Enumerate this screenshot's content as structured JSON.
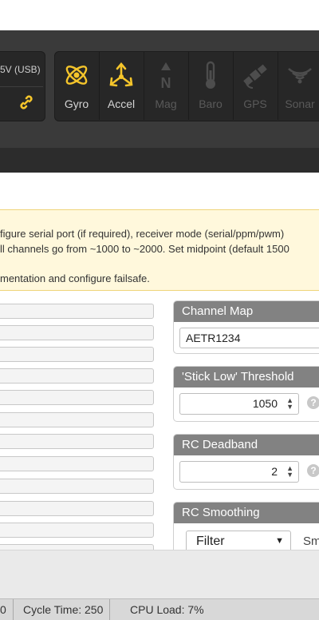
{
  "header": {
    "voltage_label": "5V (USB)",
    "link_icon": "link-icon",
    "sensors": [
      {
        "label": "Gyro",
        "icon": "gyro-icon",
        "active": true
      },
      {
        "label": "Accel",
        "icon": "accel-icon",
        "active": true
      },
      {
        "label": "Mag",
        "icon": "mag-icon",
        "active": false
      },
      {
        "label": "Baro",
        "icon": "baro-icon",
        "active": false
      },
      {
        "label": "GPS",
        "icon": "gps-icon",
        "active": false
      },
      {
        "label": "Sonar",
        "icon": "sonar-icon",
        "active": false
      }
    ],
    "active_color": "#f5c52b",
    "inactive_color": "#4d4d4d"
  },
  "notice": {
    "line1": "figure serial port (if required), receiver mode (serial/ppm/pwm)",
    "line2": "ll channels go from ~1000 to ~2000. Set midpoint (default 1500",
    "line3": "mentation and configure failsafe.",
    "background": "#fff8dc"
  },
  "channel_map": {
    "title": "Channel Map",
    "value": "AETR1234"
  },
  "stick_low": {
    "title": "'Stick Low' Threshold",
    "value": "1050",
    "help": "?"
  },
  "rc_deadband": {
    "title": "RC Deadband",
    "value": "2",
    "help": "?"
  },
  "rc_smoothing": {
    "title": "RC Smoothing",
    "type_value": "Filter",
    "label_partial": "Sm"
  },
  "status_bar": {
    "left_partial": "0",
    "cycle_time": "Cycle Time: 250",
    "cpu_load": "CPU Load: 7%"
  }
}
